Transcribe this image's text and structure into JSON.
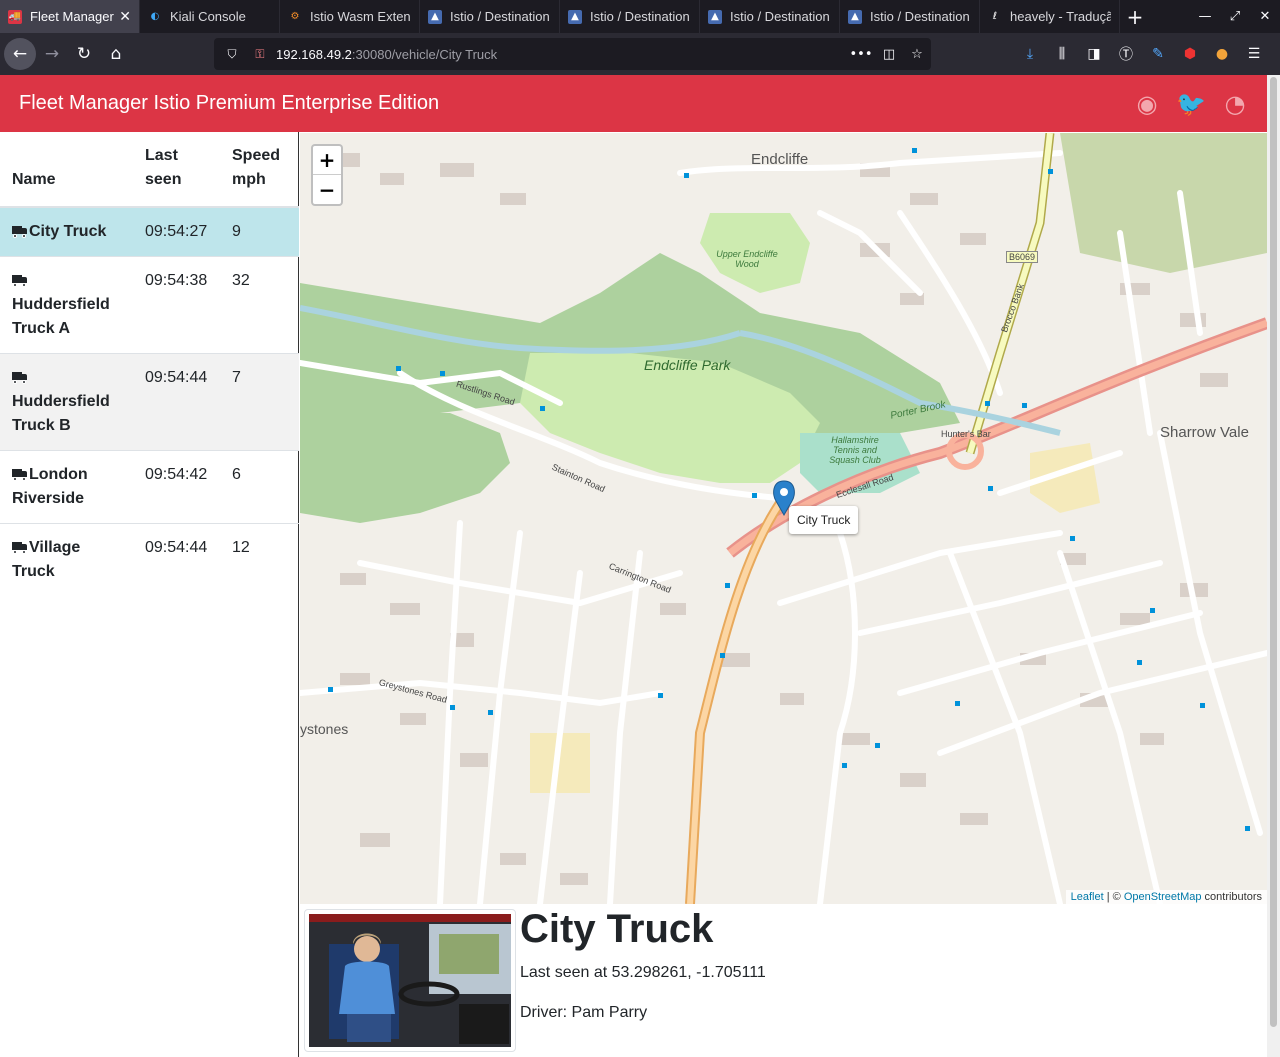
{
  "browser": {
    "tabs": [
      {
        "label": "Fleet Manager",
        "active": true,
        "icon": "truck-icon"
      },
      {
        "label": "Kiali Console",
        "active": false,
        "icon": "kiali-icon"
      },
      {
        "label": "Istio Wasm Exten",
        "active": false,
        "icon": "gear-icon"
      },
      {
        "label": "Istio / Destination",
        "active": false,
        "icon": "istio-icon"
      },
      {
        "label": "Istio / Destination",
        "active": false,
        "icon": "istio-icon"
      },
      {
        "label": "Istio / Destination",
        "active": false,
        "icon": "istio-icon"
      },
      {
        "label": "Istio / Destination",
        "active": false,
        "icon": "istio-icon"
      },
      {
        "label": "heavely - Tradução",
        "active": false,
        "icon": "dictionary-icon"
      }
    ],
    "url_host": "192.168.49.2",
    "url_path": ":30080/vehicle/City Truck"
  },
  "header": {
    "title": "Fleet Manager Istio Premium Enterprise Edition",
    "accent": "#dc3545",
    "icons": [
      "github-icon",
      "twitter-icon",
      "rss-icon"
    ]
  },
  "vehicles": {
    "columns": {
      "name": "Name",
      "last_seen": "Last seen",
      "speed": "Speed mph"
    },
    "rows": [
      {
        "name": "City Truck",
        "last_seen": "09:54:27",
        "speed": "9",
        "selected": true
      },
      {
        "name": "Huddersfield Truck A",
        "last_seen": "09:54:38",
        "speed": "32",
        "selected": false
      },
      {
        "name": "Huddersfield Truck B",
        "last_seen": "09:54:44",
        "speed": "7",
        "selected": false
      },
      {
        "name": "London Riverside",
        "last_seen": "09:54:42",
        "speed": "6",
        "selected": false
      },
      {
        "name": "Village Truck",
        "last_seen": "09:54:44",
        "speed": "12",
        "selected": false
      }
    ]
  },
  "map": {
    "zoom_in": "+",
    "zoom_out": "−",
    "marker_tooltip": "City Truck",
    "attribution_leaflet": "Leaflet",
    "attribution_sep": " | © ",
    "attribution_osm": "OpenStreetMap",
    "attribution_suffix": " contributors",
    "labels": {
      "endcliffe": "Endcliffe",
      "endcliffe_park": "Endcliffe Park",
      "sharrow_vale": "Sharrow Vale",
      "porter_brook": "Porter Brook",
      "hallamshire": "Hallamshire Tennis and Squash Club",
      "upper_endcliffe_wood": "Upper Endcliffe Wood",
      "hunters_bar": "Hunter's Bar",
      "ecclesall_road": "Ecclesall Road",
      "b6069": "B6069",
      "rustlings_road": "Rustlings Road",
      "greystones": "ystones",
      "brocco_bank": "Brocco Bank",
      "stainton_road": "Stainton Road",
      "carrington_road": "Carrington Road",
      "greystones_road": "Greystones Road"
    }
  },
  "detail": {
    "title": "City Truck",
    "last_seen": "Last seen at 53.298261, -1.705111",
    "driver": "Driver: Pam Parry"
  }
}
